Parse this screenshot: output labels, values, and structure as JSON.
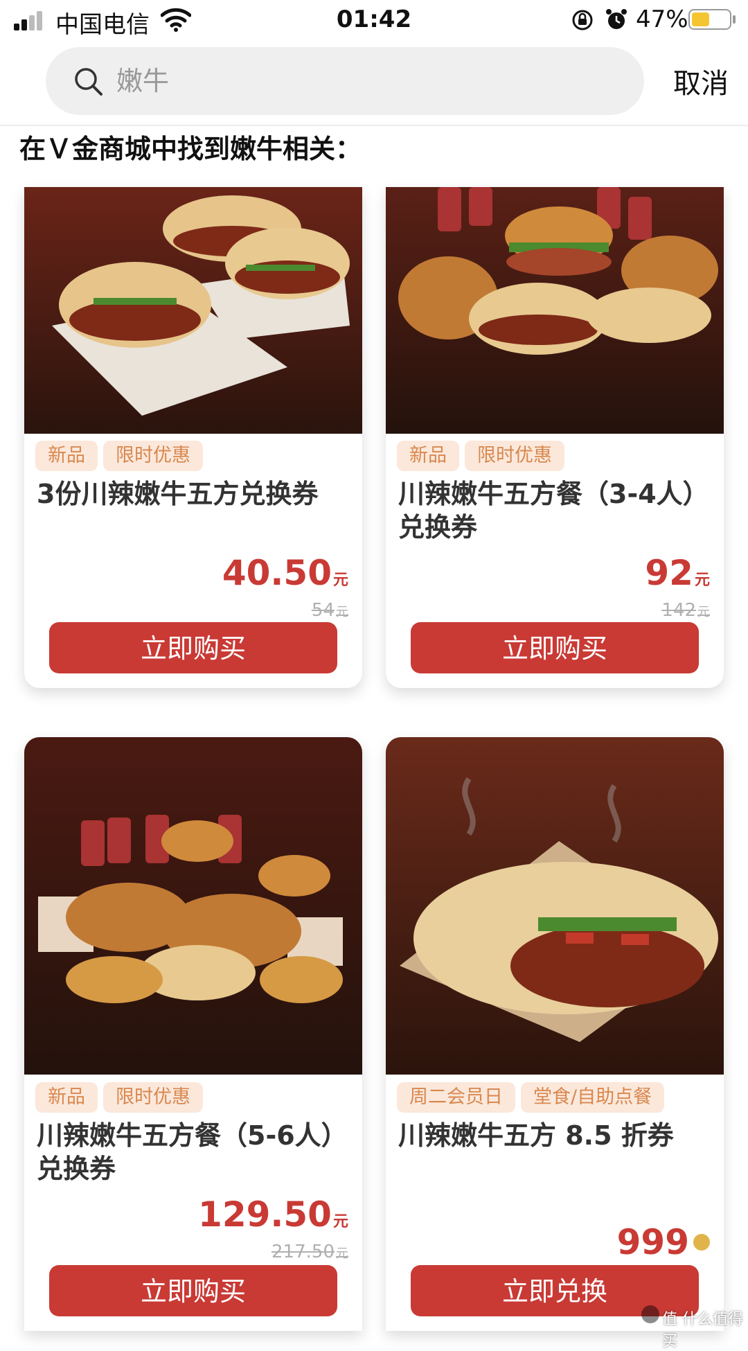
{
  "status_bar": {
    "carrier": "中国电信",
    "time": "01:42",
    "battery": "47%",
    "battery_level": 0.47,
    "icons": [
      "signal-icon",
      "wifi-icon",
      "rotation-lock-icon",
      "alarm-icon",
      "battery-icon"
    ]
  },
  "search": {
    "placeholder": "嫩牛",
    "cancel_label": "取消"
  },
  "results_heading": "在Ｖ金商城中找到嫩牛相关：",
  "products": [
    {
      "tags": [
        "新品",
        "限时优惠"
      ],
      "title": "3份川辣嫩牛五方兑换券",
      "price": "40.50",
      "price_unit": "元",
      "original_price": "54",
      "original_unit": "元",
      "button": "立即购买"
    },
    {
      "tags": [
        "新品",
        "限时优惠"
      ],
      "title": "川辣嫩牛五方餐（3-4人）兑换券",
      "price": "92",
      "price_unit": "元",
      "original_price": "142",
      "original_unit": "元",
      "button": "立即购买"
    },
    {
      "tags": [
        "新品",
        "限时优惠"
      ],
      "title": "川辣嫩牛五方餐（5-6人）兑换券",
      "price": "129.50",
      "price_unit": "元",
      "original_price": "217.50",
      "original_unit": "元",
      "button": "立即购买"
    },
    {
      "tags": [
        "周二会员日",
        "堂食/自助点餐"
      ],
      "title": "川辣嫩牛五方 8.5 折券",
      "price": "999",
      "price_unit": "",
      "original_price": "",
      "original_unit": "",
      "button": "立即兑换"
    }
  ],
  "watermark": "值 什么值得买",
  "colors": {
    "accent": "#c93a35",
    "tag_bg": "#fbe8db",
    "tag_text": "#d8884f",
    "battery": "#f5c531"
  }
}
